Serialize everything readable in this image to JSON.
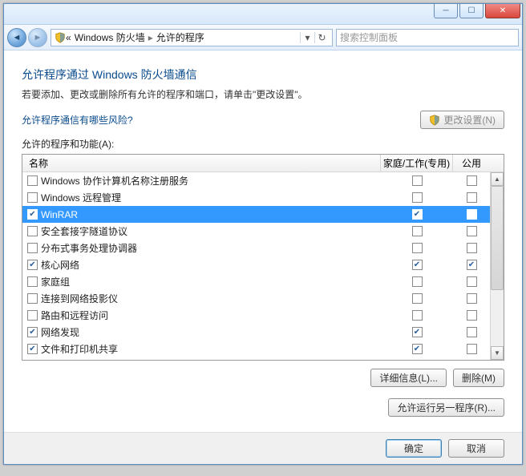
{
  "window": {
    "breadcrumb_prefix": "«",
    "breadcrumb_1": "Windows 防火墙",
    "breadcrumb_2": "允许的程序",
    "search_placeholder": "搜索控制面板"
  },
  "page": {
    "title": "允许程序通过 Windows 防火墙通信",
    "desc": "若要添加、更改或删除所有允许的程序和端口，请单击\"更改设置\"。",
    "risk_link": "允许程序通信有哪些风险?",
    "change_settings_btn": "更改设置(N)"
  },
  "list": {
    "group_label": "允许的程序和功能(A):",
    "col_name": "名称",
    "col_home": "家庭/工作(专用)",
    "col_public": "公用"
  },
  "rows": [
    {
      "enabled": false,
      "name": "Windows 协作计算机名称注册服务",
      "home": false,
      "public": false,
      "selected": false
    },
    {
      "enabled": false,
      "name": "Windows 远程管理",
      "home": false,
      "public": false,
      "selected": false
    },
    {
      "enabled": true,
      "name": "WinRAR",
      "home": true,
      "public": false,
      "selected": true
    },
    {
      "enabled": false,
      "name": "安全套接字隧道协议",
      "home": false,
      "public": false,
      "selected": false
    },
    {
      "enabled": false,
      "name": "分布式事务处理协调器",
      "home": false,
      "public": false,
      "selected": false
    },
    {
      "enabled": true,
      "name": "核心网络",
      "home": true,
      "public": true,
      "selected": false
    },
    {
      "enabled": false,
      "name": "家庭组",
      "home": false,
      "public": false,
      "selected": false
    },
    {
      "enabled": false,
      "name": "连接到网络投影仪",
      "home": false,
      "public": false,
      "selected": false
    },
    {
      "enabled": false,
      "name": "路由和远程访问",
      "home": false,
      "public": false,
      "selected": false
    },
    {
      "enabled": true,
      "name": "网络发现",
      "home": true,
      "public": false,
      "selected": false
    },
    {
      "enabled": true,
      "name": "文件和打印机共享",
      "home": true,
      "public": false,
      "selected": false
    }
  ],
  "buttons": {
    "details": "详细信息(L)...",
    "remove": "删除(M)",
    "allow_another": "允许运行另一程序(R)...",
    "ok": "确定",
    "cancel": "取消"
  }
}
